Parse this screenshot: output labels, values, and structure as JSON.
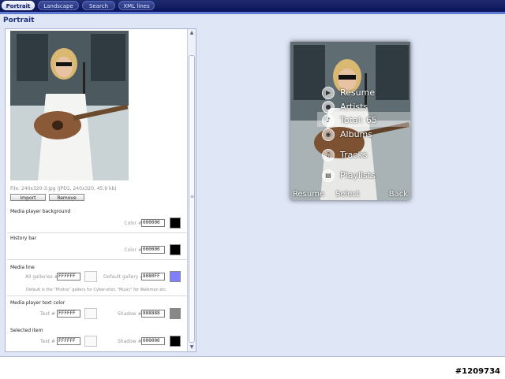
{
  "tabs": [
    {
      "label": "Portrait",
      "active": true
    },
    {
      "label": "Landscape",
      "active": false
    },
    {
      "label": "Search",
      "active": false
    },
    {
      "label": "XML lines",
      "active": false
    }
  ],
  "page_title": "Portrait",
  "file_info": "File: 240x320-3.jpg (JPEG, 240x320, 45.9 kb)",
  "buttons": {
    "import": "Import",
    "remove": "Remove"
  },
  "sections": {
    "background": {
      "title": "Media player background",
      "color_label": "Color #",
      "color_value": "000000",
      "swatch": "#000000"
    },
    "history": {
      "title": "History bar",
      "color_label": "Color #",
      "color_value": "000000",
      "swatch": "#000000"
    },
    "media_line": {
      "title": "Media line",
      "all_label": "All galleries #",
      "all_value": "FFFFFF",
      "default_label": "Default gallery #",
      "default_value": "8080FF",
      "default_swatch": "#8080ff",
      "note": "Default is the \"Photos\" gallery for Cyber-shot, \"Music\" for Walkman etc."
    },
    "text_color": {
      "title": "Media player text color",
      "text_label": "Text #",
      "text_value": "FFFFFF",
      "shadow_label": "Shadow #",
      "shadow_value": "888888",
      "shadow_swatch": "#888888"
    },
    "selected": {
      "title": "Selected item",
      "text_label": "Text #",
      "text_value": "FFFFFF",
      "shadow_label": "Shadow #",
      "shadow_value": "000000",
      "shadow_swatch": "#000000"
    }
  },
  "preview": {
    "menu": [
      {
        "label": "Resume",
        "icon": "play-icon"
      },
      {
        "label": "Artists",
        "icon": "artist-icon"
      },
      {
        "label": "Total: 65",
        "icon": "music-note-icon"
      },
      {
        "label": "Albums",
        "icon": "album-icon"
      },
      {
        "label": "Tracks",
        "icon": "note-icon"
      },
      {
        "label": "Playlists",
        "icon": "playlist-icon"
      }
    ],
    "softkeys": {
      "left": "Resume",
      "center": "Select",
      "right": "Back"
    }
  },
  "image_tag": "#1209734",
  "colors": {
    "tabbar": "#0b145a",
    "page_bg": "#dfe6f6",
    "accent": "#5e7bd1"
  }
}
